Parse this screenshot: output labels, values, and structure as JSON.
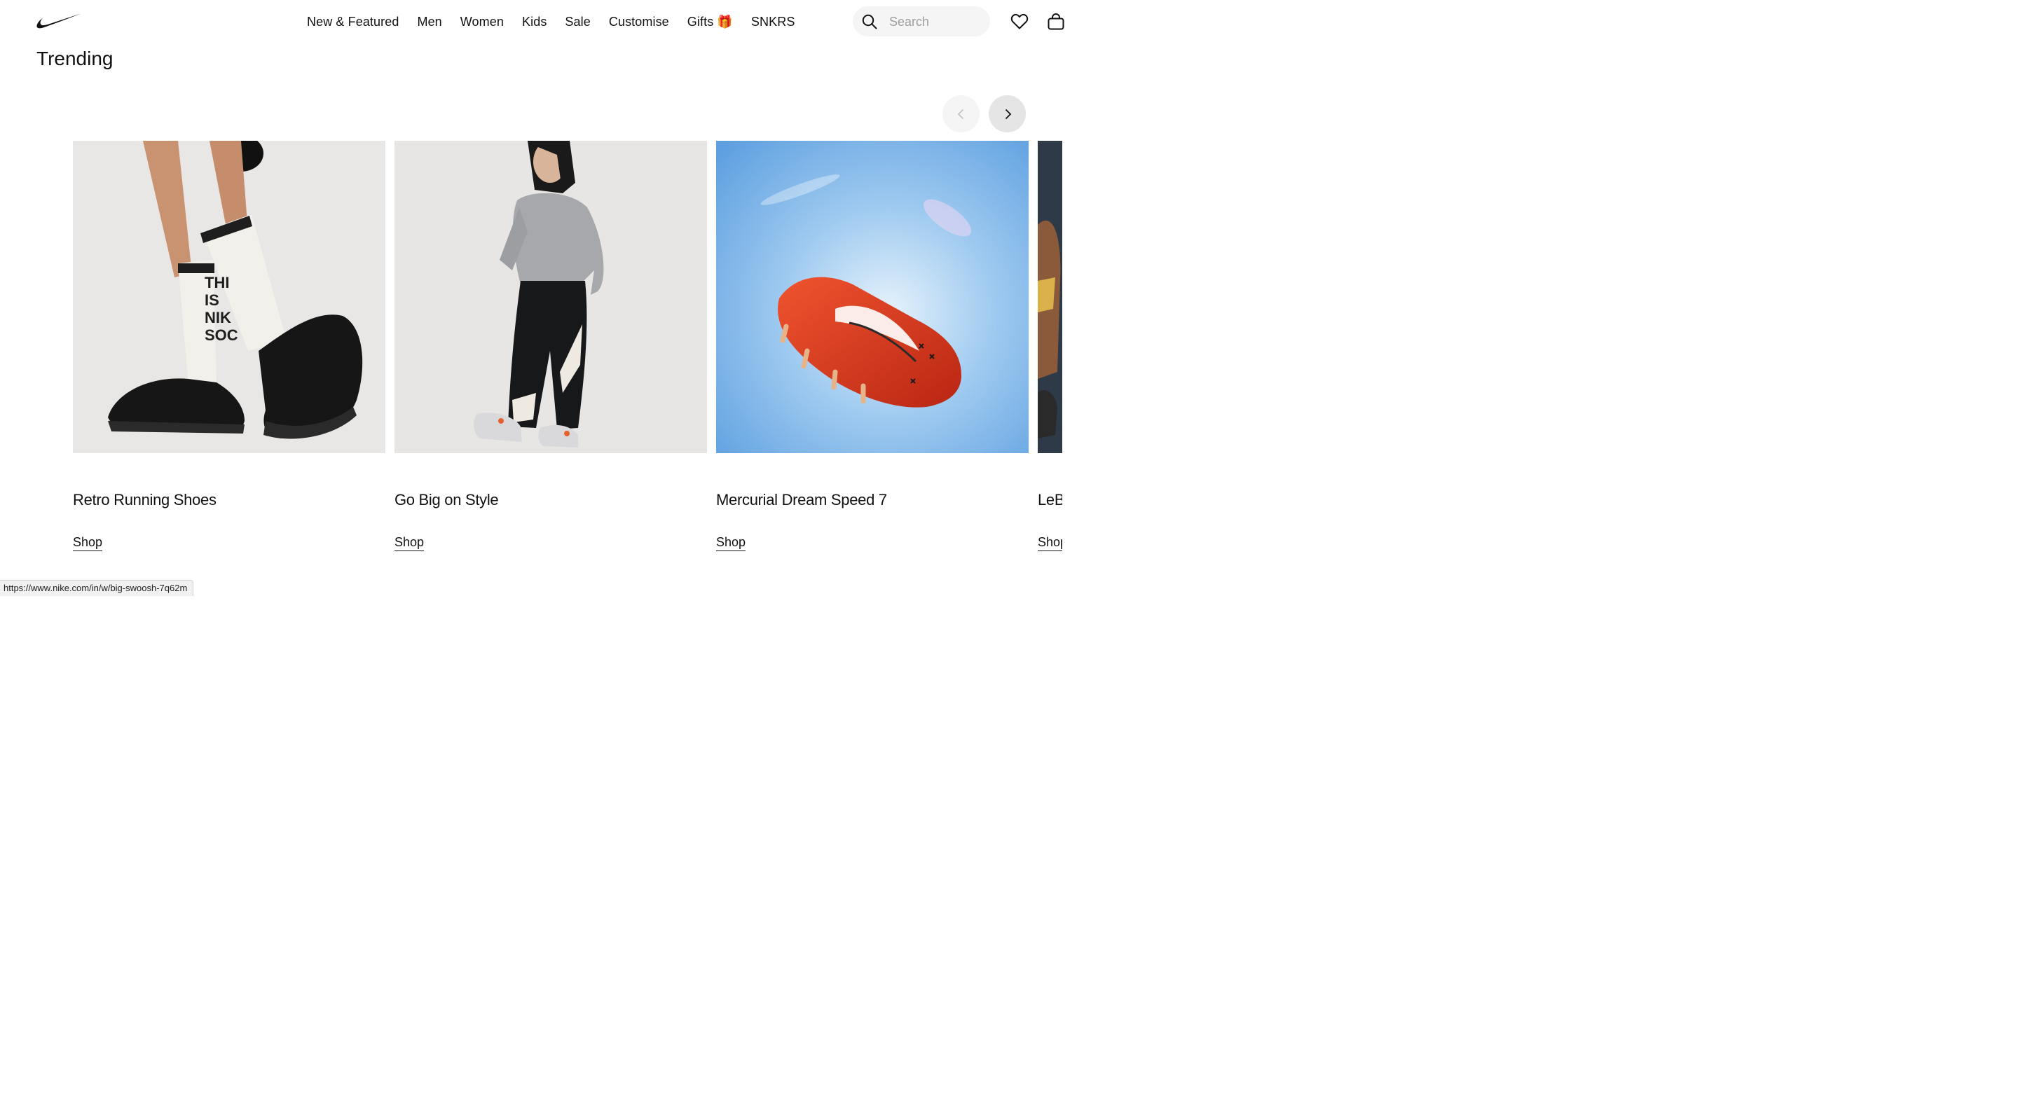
{
  "header": {
    "logo": "nike-swoosh",
    "nav": [
      "New & Featured",
      "Men",
      "Women",
      "Kids",
      "Sale",
      "Customise",
      "Gifts 🎁",
      "SNKRS"
    ],
    "search": {
      "placeholder": "Search"
    }
  },
  "section": {
    "title": "Trending"
  },
  "carousel": {
    "prev_icon": "chevron-left-icon",
    "next_icon": "chevron-right-icon",
    "cards": [
      {
        "title": "Retro Running Shoes",
        "link": "Shop"
      },
      {
        "title": "Go Big on Style",
        "link": "Shop"
      },
      {
        "title": "Mercurial Dream Speed 7",
        "link": "Shop"
      },
      {
        "title": "LeB",
        "link": "Shop"
      }
    ]
  },
  "status_bar": {
    "url": "https://www.nike.com/in/w/big-swoosh-7q62m"
  },
  "colors": {
    "text": "#111111",
    "background": "#ffffff",
    "search_bg": "#f5f5f5",
    "boot_red": "#e03a1c",
    "sky_blue": "#7fb6e6"
  }
}
